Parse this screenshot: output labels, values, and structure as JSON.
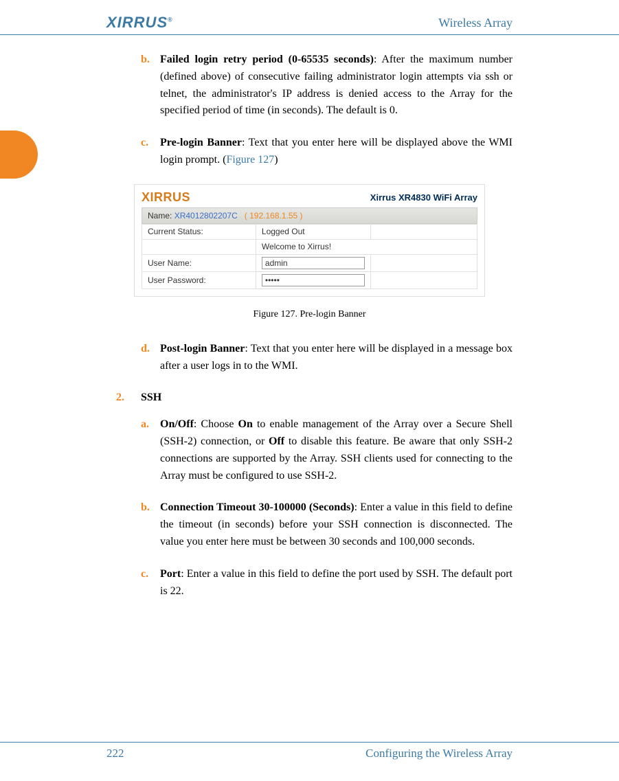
{
  "header": {
    "logo_text": "XIRRUS",
    "title": "Wireless Array"
  },
  "items": {
    "b": {
      "marker": "b.",
      "bold": "Failed login retry period (0-65535 seconds)",
      "rest": ": After the maximum number (defined above) of consecutive failing administrator login attempts via ssh or telnet, the administrator's IP address is denied access to the Array for the specified period of time (in seconds). The default is 0."
    },
    "c": {
      "marker": "c.",
      "bold": "Pre-login Banner",
      "rest_pre": ": Text that you enter here will be displayed above the WMI login prompt. (",
      "fig_ref": "Figure 127",
      "rest_post": ")"
    },
    "d": {
      "marker": "d.",
      "bold": "Post-login Banner",
      "rest": ": Text that you enter here will be displayed in a message box after a user logs in to the WMI."
    },
    "num2": {
      "marker": "2.",
      "text": "SSH"
    },
    "a2": {
      "marker": "a.",
      "bold": "On/Off",
      "rest_pre": ": Choose ",
      "bold2": "On",
      "rest_mid": " to enable management of the Array over a Secure Shell (SSH-2) connection, or ",
      "bold3": "Off",
      "rest_post": " to disable this feature. Be aware that only SSH-2 connections are supported by the Array. SSH clients used for connecting to the Array must be configured to use SSH-2."
    },
    "b2": {
      "marker": "b.",
      "bold": "Connection Timeout 30-100000 (Seconds)",
      "rest": ": Enter a value in this field to define the timeout (in seconds) before your SSH connection is disconnected. The value you enter here must be between 30 seconds and 100,000 seconds."
    },
    "c2": {
      "marker": "c.",
      "bold": "Port",
      "rest": ": Enter a value in this field to define the port used by SSH. The default port is 22."
    }
  },
  "figure": {
    "caption": "Figure 127. Pre-login Banner",
    "logo_text": "XIRRUS",
    "model": "Xirrus XR4830 WiFi Array",
    "name_label": "Name:",
    "name_value": "XR4012802207C",
    "ip_value": "( 192.168.1.55 )",
    "rows": {
      "status_label": "Current Status:",
      "status_value": "Logged Out",
      "banner_value": "Welcome to Xirrus!",
      "user_label": "User Name:",
      "user_value": "admin",
      "pass_label": "User Password:",
      "pass_value": "•••••"
    }
  },
  "footer": {
    "page": "222",
    "section": "Configuring the Wireless Array"
  }
}
